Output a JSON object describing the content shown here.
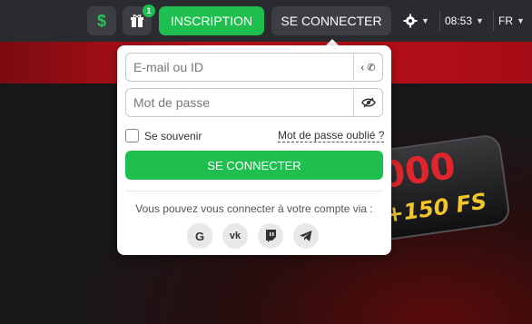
{
  "header": {
    "wallet_icon": "dollar-icon",
    "gift_badge": "1",
    "inscription_label": "INSCRIPTION",
    "connect_label": "SE CONNECTER",
    "clock": "08:53",
    "language": "FR"
  },
  "login": {
    "email_placeholder": "E-mail ou ID",
    "password_placeholder": "Mot de passe",
    "remember_label": "Se souvenir",
    "forgot_label": "Mot de passe oublié ?",
    "submit_label": "SE CONNECTER",
    "via_text": "Vous pouvez vous connecter à votre compte via :",
    "social_icons": [
      "google-icon",
      "vk-icon",
      "twitch-icon",
      "telegram-icon"
    ]
  },
  "promo": {
    "number": "000",
    "free_spins": "+150 FS"
  },
  "colors": {
    "accent_green": "#1fbf4f",
    "header_bg": "#2a2b2f"
  }
}
